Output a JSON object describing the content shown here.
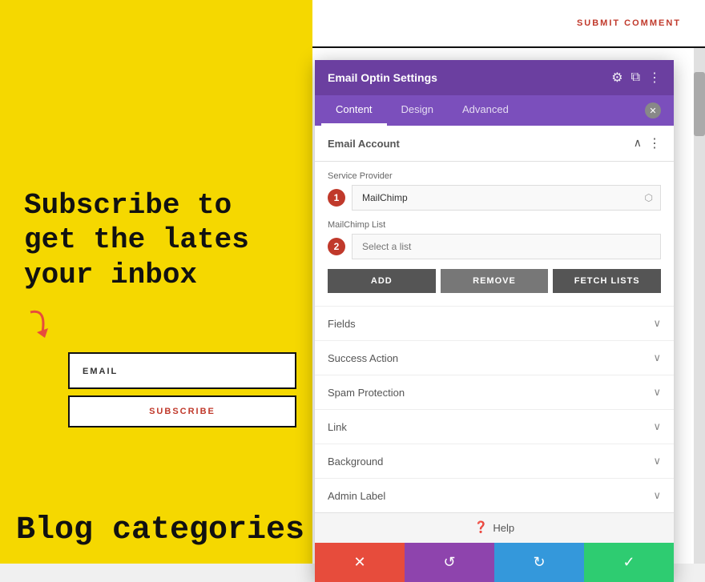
{
  "page": {
    "submit_comment": "SUBMIT COMMENT"
  },
  "yellow_section": {
    "subscribe_text": "Subscribe to get the lates your inbox",
    "email_label": "EMAIL",
    "subscribe_btn": "SUBSCRIBE"
  },
  "blog_categories": {
    "text": "Blog categories"
  },
  "modal": {
    "title": "Email Optin Settings",
    "tabs": [
      "Content",
      "Design",
      "Advanced"
    ],
    "active_tab": "Content",
    "section_title": "Email Account",
    "service_provider_label": "Service Provider",
    "service_provider_value": "MailChimp",
    "mailchimp_list_label": "MailChimp List",
    "mailchimp_list_placeholder": "Select a list",
    "btn_add": "ADD",
    "btn_remove": "REMOVE",
    "btn_fetch": "FETCH LISTS",
    "collapsible_items": [
      "Fields",
      "Success Action",
      "Spam Protection",
      "Link",
      "Background",
      "Admin Label"
    ],
    "help_text": "Help",
    "footer_actions": {
      "cancel": "✕",
      "undo": "↺",
      "redo": "↻",
      "confirm": "✓"
    }
  }
}
